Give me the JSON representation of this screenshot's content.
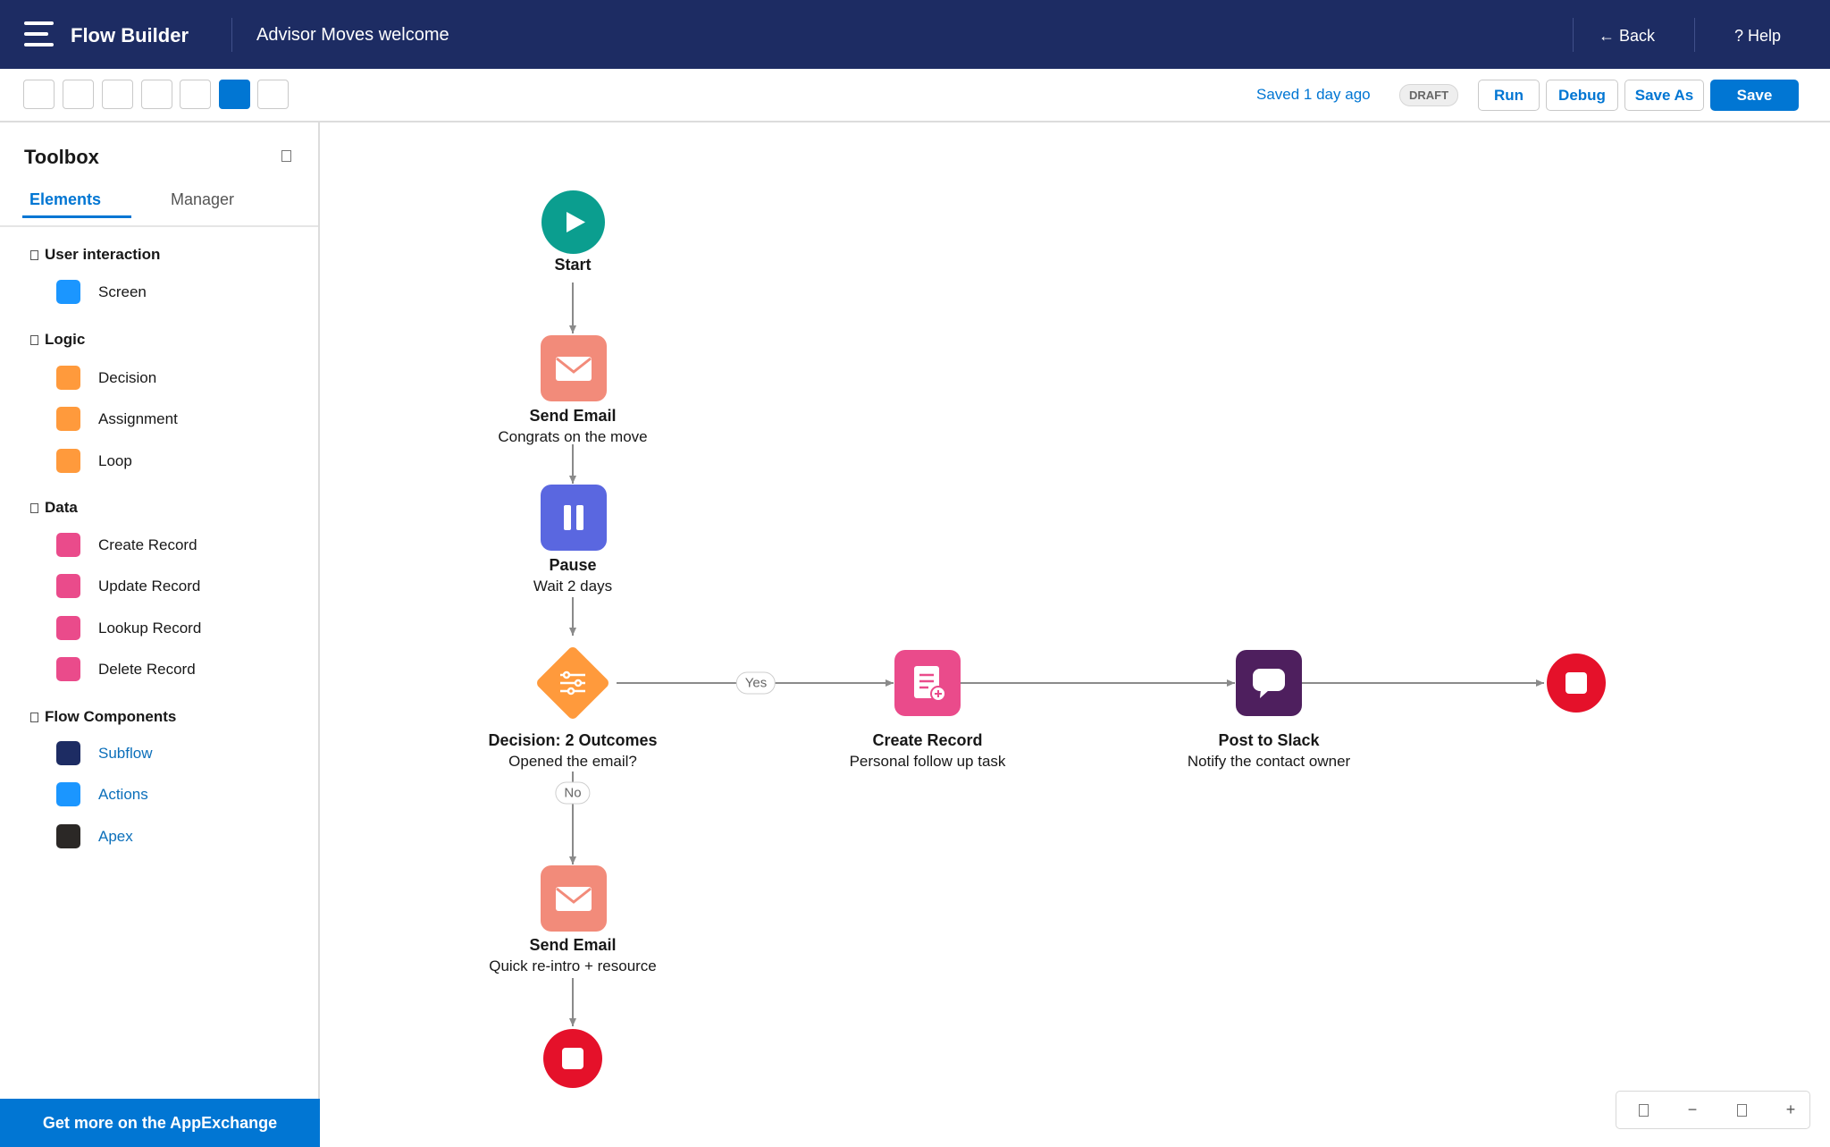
{
  "header": {
    "app_title": "Flow Builder",
    "flow_name": "Advisor Moves welcome",
    "back_label": "← Back",
    "help_label": "? Help"
  },
  "toolbar": {
    "tool_buttons": 7,
    "active_tool_index": 5,
    "saved_status": "Saved 1 day ago",
    "status_badge": "DRAFT",
    "run_label": "Run",
    "debug_label": "Debug",
    "save_as_label": "Save As",
    "save_label": "Save"
  },
  "sidebar": {
    "title": "Toolbox",
    "tabs": [
      {
        "label": "Elements",
        "active": true
      },
      {
        "label": "Manager",
        "active": false
      }
    ],
    "sections": [
      {
        "label": "User interaction",
        "items": [
          {
            "label": "Screen",
            "color": "#1b96ff",
            "link": false
          }
        ]
      },
      {
        "label": "Logic",
        "items": [
          {
            "label": "Decision",
            "color": "#ff9a3c",
            "link": false
          },
          {
            "label": "Assignment",
            "color": "#ff9a3c",
            "link": false
          },
          {
            "label": "Loop",
            "color": "#ff9a3c",
            "link": false
          }
        ]
      },
      {
        "label": "Data",
        "items": [
          {
            "label": "Create Record",
            "color": "#ea4b8b",
            "link": false
          },
          {
            "label": "Update Record",
            "color": "#ea4b8b",
            "link": false
          },
          {
            "label": "Lookup Record",
            "color": "#ea4b8b",
            "link": false
          },
          {
            "label": "Delete Record",
            "color": "#ea4b8b",
            "link": false
          }
        ]
      },
      {
        "label": "Flow Components",
        "items": [
          {
            "label": "Subflow",
            "color": "#1d2c63",
            "link": true
          },
          {
            "label": "Actions",
            "color": "#1b96ff",
            "link": true
          },
          {
            "label": "Apex",
            "color": "#2b2826",
            "link": true
          }
        ]
      }
    ],
    "appexchange_label": "Get more on the AppExchange"
  },
  "canvas": {
    "nodes": {
      "start": {
        "title": "Start"
      },
      "email1": {
        "title": "Send Email",
        "subtitle": "Congrats on the move"
      },
      "pause": {
        "title": "Pause",
        "subtitle": "Wait 2 days"
      },
      "decision": {
        "title": "Decision: 2 Outcomes",
        "subtitle": "Opened the email?"
      },
      "create": {
        "title": "Create Record",
        "subtitle": "Personal follow up task"
      },
      "slack": {
        "title": "Post to Slack",
        "subtitle": "Notify the contact owner"
      },
      "email2": {
        "title": "Send Email",
        "subtitle": "Quick re-intro + resource"
      }
    },
    "yes_label": "Yes",
    "no_label": "No"
  },
  "zoom_controls": {
    "minus": "−",
    "plus": "+"
  },
  "colors": {
    "header_bg": "#1d2c63",
    "accent": "#0176d3",
    "start": "#0b9e8f",
    "email": "#f28b7a",
    "pause": "#5a67e0",
    "decision": "#ff9a3c",
    "create": "#ea4b8b",
    "slack": "#4e1f5e",
    "end": "#e5112a"
  }
}
